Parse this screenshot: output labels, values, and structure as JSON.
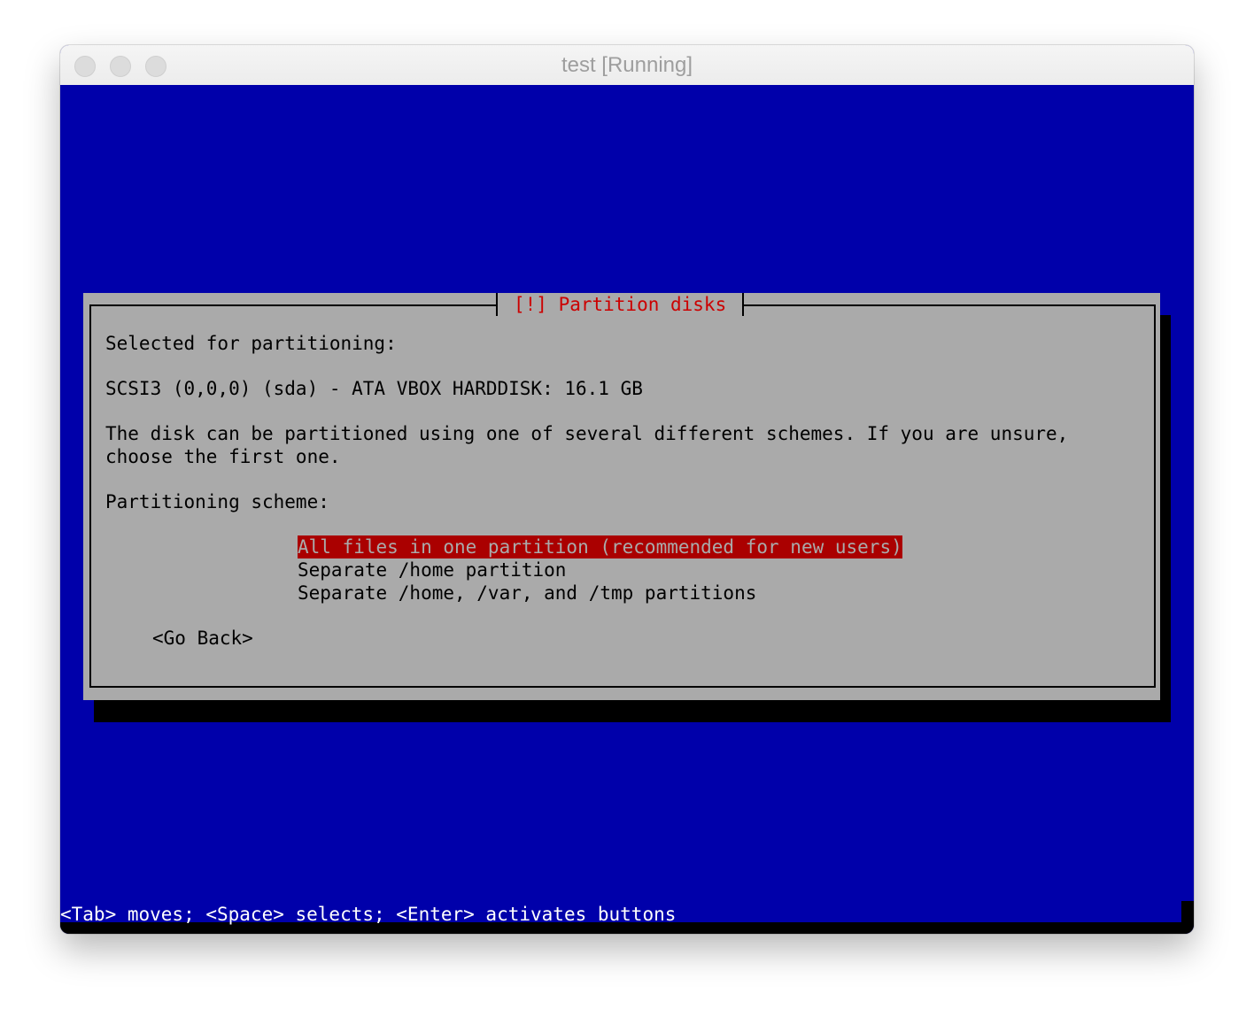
{
  "window": {
    "title": "test [Running]"
  },
  "dialog": {
    "title": "[!] Partition disks",
    "selected_label": "Selected for partitioning:",
    "disk": "SCSI3 (0,0,0) (sda) - ATA VBOX HARDDISK: 16.1 GB",
    "description_line1": "The disk can be partitioned using one of several different schemes. If you are unsure,",
    "description_line2": "choose the first one.",
    "scheme_label": "Partitioning scheme:",
    "options": [
      {
        "label": "All files in one partition (recommended for new users)",
        "selected": true
      },
      {
        "label": "Separate /home partition",
        "selected": false
      },
      {
        "label": "Separate /home, /var, and /tmp partitions",
        "selected": false
      }
    ],
    "go_back": "<Go Back>"
  },
  "status_bar": "<Tab> moves; <Space> selects; <Enter> activates buttons",
  "colors": {
    "screen_bg": "#0000aa",
    "dialog_bg": "#aaaaaa",
    "title_text": "#cc0000",
    "selection_bg": "#aa0000",
    "status_text": "#ffffff"
  }
}
